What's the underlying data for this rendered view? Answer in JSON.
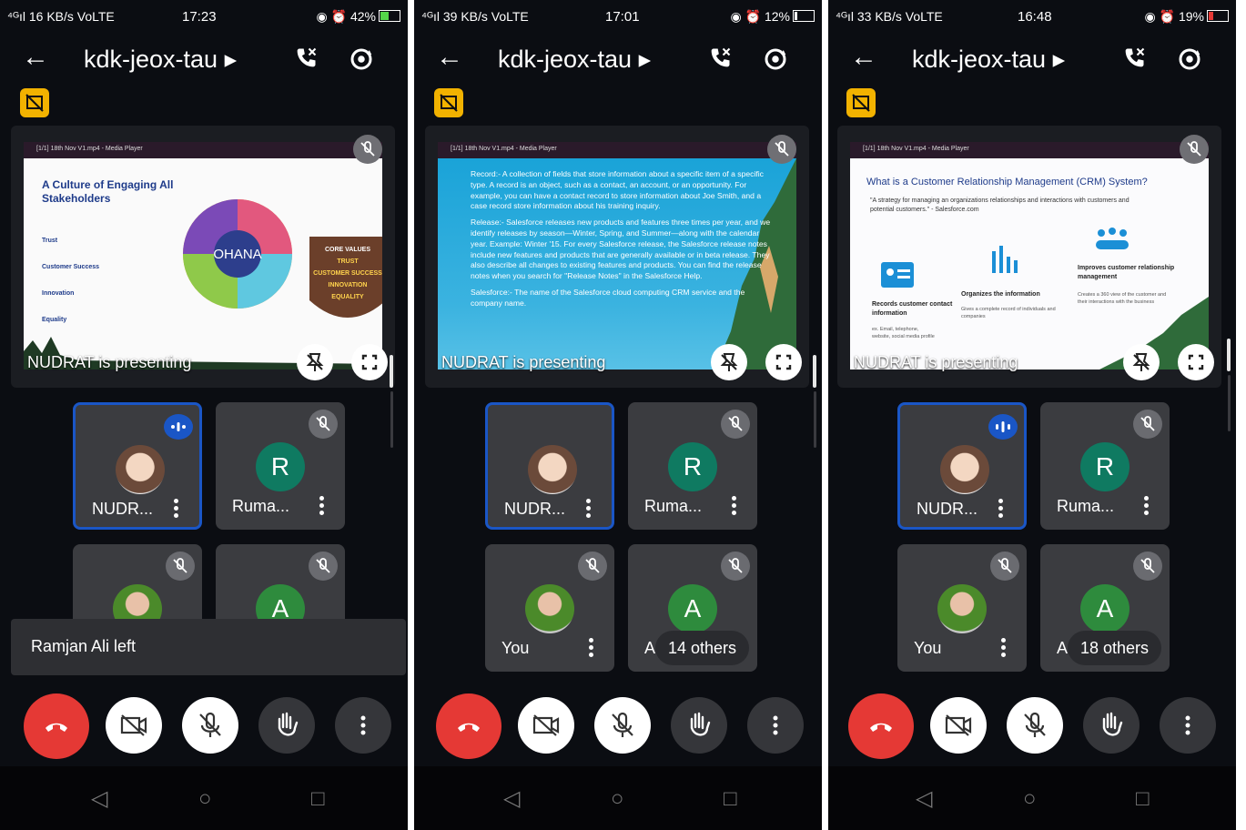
{
  "panels": [
    {
      "status": {
        "signal": "⁴ᴳıl 16 KB/s VoLTE",
        "time": "17:23",
        "right": "42%"
      },
      "header": {
        "title": "kdk-jeox-tau ▸"
      },
      "media_player_title": "[1/1] 18th Nov V1.mp4 - Media Player",
      "presenting_label": "NUDRAT is presenting",
      "slide": {
        "heading": "A Culture of Engaging All Stakeholders",
        "items": [
          "Trust",
          "Customer Success",
          "Innovation",
          "Equality"
        ],
        "center": "OHANA",
        "core_values": [
          "CORE VALUES",
          "TRUST",
          "CUSTOMER SUCCESS",
          "INNOVATION",
          "EQUALITY"
        ]
      },
      "tiles": [
        {
          "name": "NUDR...",
          "kind": "photo"
        },
        {
          "name": "Ruma...",
          "letter": "R"
        },
        {
          "name": "",
          "kind": "photo2"
        },
        {
          "name": "",
          "letter": "A"
        }
      ],
      "toast": "Ramjan Ali left"
    },
    {
      "status": {
        "signal": "⁴ᴳıl 39 KB/s VoLTE",
        "time": "17:01",
        "right": "12%"
      },
      "header": {
        "title": "kdk-jeox-tau ▸"
      },
      "media_player_title": "[1/1] 18th Nov V1.mp4 - Media Player",
      "presenting_label": "NUDRAT is presenting",
      "slide": {
        "p1": "Record:- A collection of fields that store information about a specific item of a specific type. A record is an object, such as a contact, an account, or an opportunity. For example, you can have a contact record to store information about Joe Smith, and a case record store information about his training inquiry.",
        "p2": "Release:- Salesforce releases new products and features three times per year, and we identify releases by season—Winter, Spring, and Summer—along with the calendar year. Example: Winter '15. For every Salesforce release, the Salesforce release notes include new features and products that are generally available or in beta release. They also describe all changes to existing features and products. You can find the release notes when you search for \"Release Notes\" in the Salesforce Help.",
        "p3": "Salesforce:- The name of the Salesforce cloud computing CRM service and the company name."
      },
      "tiles": [
        {
          "name": "NUDR...",
          "kind": "photo"
        },
        {
          "name": "Ruma...",
          "letter": "R"
        },
        {
          "name": "You",
          "kind": "photo2"
        },
        {
          "name": "A",
          "letter": "A",
          "others": "14 others"
        }
      ]
    },
    {
      "status": {
        "signal": "⁴ᴳıl 33 KB/s VoLTE",
        "time": "16:48",
        "right": "19%"
      },
      "header": {
        "title": "kdk-jeox-tau ▸"
      },
      "media_player_title": "[1/1] 18th Nov V1.mp4 - Media Player",
      "presenting_label": "NUDRAT is presenting",
      "slide": {
        "heading": "What is a Customer Relationship Management (CRM) System?",
        "quote": "\"A strategy for managing an organizations relationships and interactions with customers and potential customers.\" - Salesforce.com",
        "c1": "Records customer contact information",
        "c1s": "ex. Email, telephone, website, social media profile",
        "c2": "Organizes the information",
        "c2s": "Gives a complete record of individuals and companies",
        "c3": "Improves customer relationship management",
        "c3s": "Creates a 360 view of the customer and their interactions with the business"
      },
      "tiles": [
        {
          "name": "NUDR...",
          "kind": "photo"
        },
        {
          "name": "Ruma...",
          "letter": "R"
        },
        {
          "name": "You",
          "kind": "photo2"
        },
        {
          "name": "A",
          "letter": "A",
          "others": "18 others"
        }
      ]
    }
  ],
  "colors": {
    "end_call": "#e53935",
    "accent": "#1a56c6",
    "r_avatar": "#0f7a61",
    "a_avatar": "#2e8b3d",
    "badge": "#f2b200"
  }
}
